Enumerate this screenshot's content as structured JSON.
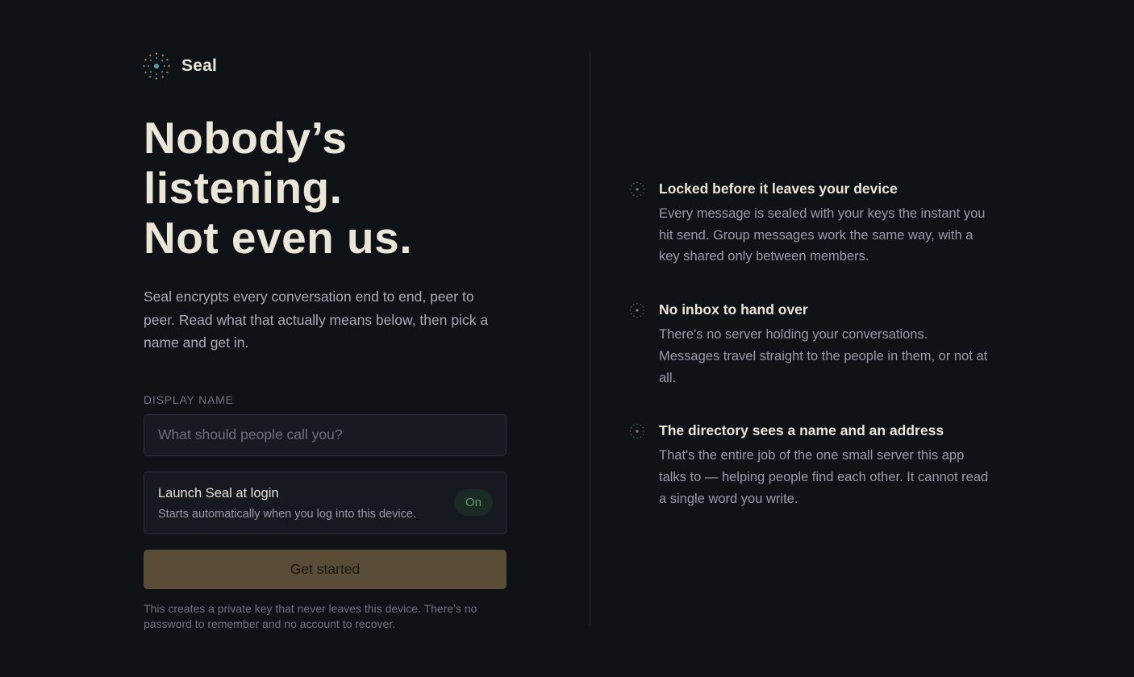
{
  "brand": {
    "name": "Seal",
    "logo_icon": "dotted-seal-icon"
  },
  "hero": {
    "lines": [
      "Nobody’s",
      "listening.",
      "Not even us."
    ],
    "lede": "Seal encrypts every conversation end to end, peer to peer. Read what that actually means below, then pick a name and get in."
  },
  "form": {
    "label": "DISPLAY NAME",
    "name_value": "",
    "name_placeholder": "What should people call you?",
    "launch": {
      "title": "Launch Seal at login",
      "subtitle": "Starts automatically when you log into this device.",
      "toggle_label": "On"
    },
    "cta_label": "Get started",
    "footnote": "This creates a private key that never leaves this device. There’s no password to remember and no account to recover."
  },
  "features": [
    {
      "icon": "dotted-seal-icon",
      "title": "Locked before it leaves your device",
      "body": "Every message is sealed with your keys the instant you hit send. Group messages work the same way, with a key shared only between members."
    },
    {
      "icon": "dotted-seal-icon",
      "title": "No inbox to hand over",
      "body": "There's no server holding your conversations. Messages travel straight to the people in them, or not at all."
    },
    {
      "icon": "dotted-seal-icon",
      "title": "The directory sees a name and an address",
      "body": "That's the entire job of the one small server this app talks to — helping people find each other. It cannot read a single word you write."
    }
  ],
  "colors": {
    "background": "#0f1217",
    "accent_button": "#5a4d38",
    "toggle_on": "#5f9a70",
    "logo_teal": "#4fa3a6",
    "logo_gold": "#b9935a"
  }
}
